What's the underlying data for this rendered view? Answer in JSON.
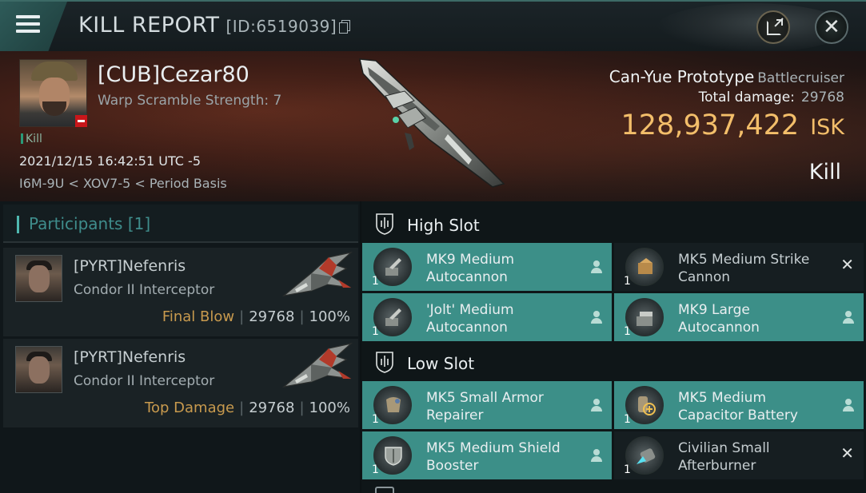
{
  "window": {
    "title": "KILL REPORT",
    "report_id": "[ID:6519039]"
  },
  "victim": {
    "name": "[CUB]Cezar80",
    "warp_scramble": "Warp Scramble Strength: 7",
    "status_tag": "Kill",
    "datetime": "2021/12/15 16:42:51 UTC -5",
    "location": "I6M-9U < XOV7-5 < Period Basis",
    "ship_name": "Can-Yue Prototype",
    "ship_class": "Battlecruiser",
    "total_damage_label": "Total damage:",
    "total_damage": "29768",
    "isk_value": "128,937,422",
    "isk_unit": "ISK",
    "result": "Kill"
  },
  "participants": {
    "title": "Participants [1]",
    "rows": [
      {
        "name": "[PYRT]Nefenris",
        "ship": "Condor II Interceptor",
        "role": "Final Blow",
        "damage": "29768",
        "percent": "100%"
      },
      {
        "name": "[PYRT]Nefenris",
        "ship": "Condor II Interceptor",
        "role": "Top Damage",
        "damage": "29768",
        "percent": "100%"
      }
    ]
  },
  "fitting": {
    "high_slot": {
      "title": "High Slot",
      "modules": [
        {
          "name": "MK9 Medium Autocannon",
          "qty": "1",
          "state": "dropped"
        },
        {
          "name": "MK5 Medium Strike Cannon",
          "qty": "1",
          "state": "destroyed"
        },
        {
          "name": "'Jolt' Medium Autocannon",
          "qty": "1",
          "state": "dropped"
        },
        {
          "name": "MK9 Large Autocannon",
          "qty": "1",
          "state": "dropped"
        }
      ]
    },
    "low_slot": {
      "title": "Low Slot",
      "modules": [
        {
          "name": "MK5 Small Armor Repairer",
          "qty": "1",
          "state": "dropped"
        },
        {
          "name": "MK5 Medium Capacitor Battery",
          "qty": "1",
          "state": "dropped"
        },
        {
          "name": "MK5 Medium Shield Booster",
          "qty": "1",
          "state": "dropped"
        },
        {
          "name": "Civilian Small Afterburner",
          "qty": "1",
          "state": "destroyed"
        }
      ]
    }
  },
  "icons": {
    "menu": "hamburger-menu-icon",
    "copy": "copy-icon",
    "share": "share-icon",
    "close": "close-icon",
    "dropped": "person-icon",
    "destroyed": "x-icon",
    "slot": "shield-slot-icon"
  },
  "colors": {
    "accent": "#3c8f88",
    "isk": "#f3be6a",
    "role": "#c89a4e",
    "participants_title": "#3f8d8c",
    "kill_badge": "#c8161a"
  }
}
